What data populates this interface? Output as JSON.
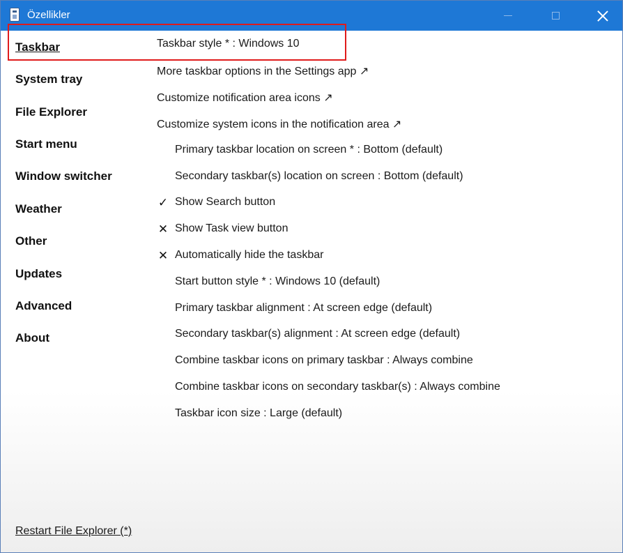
{
  "window": {
    "title": "Özellikler"
  },
  "sidebar": {
    "items": [
      {
        "label": "Taskbar"
      },
      {
        "label": "System tray"
      },
      {
        "label": "File Explorer"
      },
      {
        "label": "Start menu"
      },
      {
        "label": "Window switcher"
      },
      {
        "label": "Weather"
      },
      {
        "label": "Other"
      },
      {
        "label": "Updates"
      },
      {
        "label": "Advanced"
      },
      {
        "label": "About"
      }
    ],
    "selected": "Taskbar"
  },
  "settings": {
    "taskbar_style": "Taskbar style * : Windows 10",
    "more_options": "More taskbar options in the Settings app ↗",
    "customize_notification": "Customize notification area icons ↗",
    "customize_system_icons": "Customize system icons in the notification area ↗",
    "primary_location": "Primary taskbar location on screen * : Bottom (default)",
    "secondary_location": "Secondary taskbar(s) location on screen : Bottom (default)",
    "show_search": {
      "label": "Show Search button",
      "mark": "✓",
      "checked": true
    },
    "show_task_view": {
      "label": "Show Task view button",
      "mark": "✕",
      "checked": false
    },
    "auto_hide": {
      "label": "Automatically hide the taskbar",
      "mark": "✕",
      "checked": false
    },
    "start_button_style": "Start button style * : Windows 10 (default)",
    "primary_alignment": "Primary taskbar alignment : At screen edge (default)",
    "secondary_alignment": "Secondary taskbar(s) alignment : At screen edge (default)",
    "combine_primary": "Combine taskbar icons on primary taskbar : Always combine",
    "combine_secondary": "Combine taskbar icons on secondary taskbar(s) : Always combine",
    "icon_size": "Taskbar icon size : Large (default)"
  },
  "footer": {
    "restart_label": "Restart File Explorer (*)"
  }
}
